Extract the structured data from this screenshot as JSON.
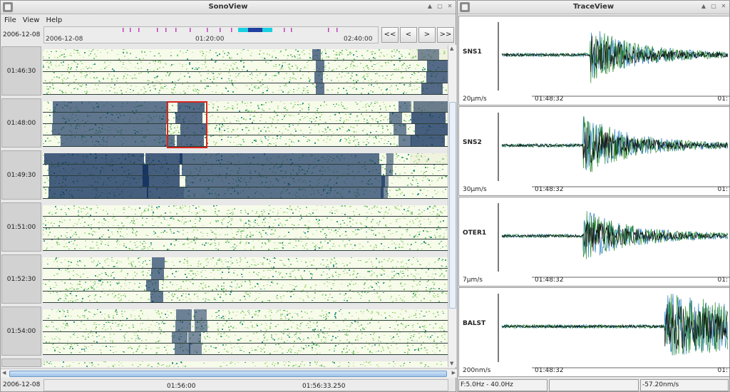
{
  "sonoview": {
    "title": "SonoView",
    "menu": [
      {
        "label": "File"
      },
      {
        "label": "View"
      },
      {
        "label": "Help"
      }
    ],
    "date": "2006-12-08",
    "ruler": {
      "date": "2006-12-08",
      "ticks": [
        "01:20:00",
        "02:40:00"
      ]
    },
    "nav_buttons": [
      "<<",
      "<",
      ">",
      ">>"
    ],
    "rows": [
      {
        "time": "01:46:30"
      },
      {
        "time": "01:48:00"
      },
      {
        "time": "01:49:30"
      },
      {
        "time": "01:51:00"
      },
      {
        "time": "01:52:30"
      },
      {
        "time": "01:54:00"
      }
    ],
    "bottom": {
      "date": "2006-12-08",
      "time1": "01:56:00",
      "time2": "01:56:33.250"
    }
  },
  "traceview": {
    "title": "TraceView",
    "traces": [
      {
        "station": "SNS1",
        "scale": "20μm/s",
        "time": "01:48:32",
        "time_right": "01:"
      },
      {
        "station": "SNS2",
        "scale": "30μm/s",
        "time": "01:48:32",
        "time_right": "01:"
      },
      {
        "station": "OTER1",
        "scale": "7μm/s",
        "time": "01:48:32",
        "time_right": "01:"
      },
      {
        "station": "BALST",
        "scale": "200nm/s",
        "time": "01:48:32",
        "time_right": "01:"
      }
    ],
    "status": {
      "filter": "F:5.0Hz - 40.0Hz",
      "middle": "",
      "value": "-57.20nm/s"
    }
  },
  "colors": {
    "spectrogram_low": "#f7fbea",
    "spectrogram_mid": "#7fc97f",
    "spectrogram_high": "#0b2a5a",
    "trace_dark": "#0a0a0a",
    "trace_green": "#2c8a2c",
    "trace_blue": "#2a7fc0",
    "marker_magenta": "#c040c0",
    "selection_red": "#d7261d"
  }
}
